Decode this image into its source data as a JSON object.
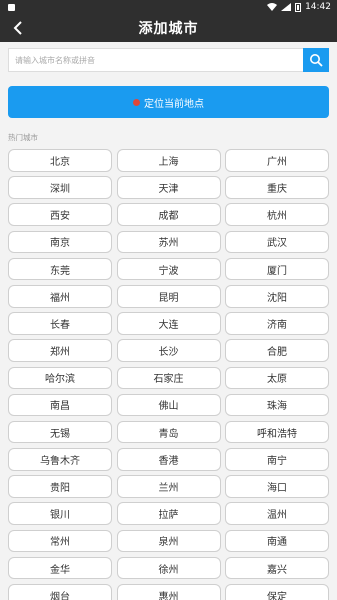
{
  "status_bar": {
    "time": "14:42"
  },
  "header": {
    "title": "添加城市",
    "back_icon": "chevron-left-icon"
  },
  "search": {
    "placeholder": "请输入城市名称或拼音",
    "value": "",
    "icon": "search-icon"
  },
  "locate": {
    "label": "定位当前地点",
    "icon": "location-pin-icon"
  },
  "hot_cities": {
    "title": "热门城市",
    "items": [
      "北京",
      "上海",
      "广州",
      "深圳",
      "天津",
      "重庆",
      "西安",
      "成都",
      "杭州",
      "南京",
      "苏州",
      "武汉",
      "东莞",
      "宁波",
      "厦门",
      "福州",
      "昆明",
      "沈阳",
      "长春",
      "大连",
      "济南",
      "郑州",
      "长沙",
      "合肥",
      "哈尔滨",
      "石家庄",
      "太原",
      "南昌",
      "佛山",
      "珠海",
      "无锡",
      "青岛",
      "呼和浩特",
      "乌鲁木齐",
      "香港",
      "南宁",
      "贵阳",
      "兰州",
      "海口",
      "银川",
      "拉萨",
      "温州",
      "常州",
      "泉州",
      "南通",
      "金华",
      "徐州",
      "嘉兴",
      "烟台",
      "惠州",
      "保定"
    ]
  },
  "colors": {
    "accent": "#1a9bf0",
    "header_bg": "#2f2f2f",
    "page_bg": "#f3f3f3",
    "pin": "#e0473a"
  }
}
